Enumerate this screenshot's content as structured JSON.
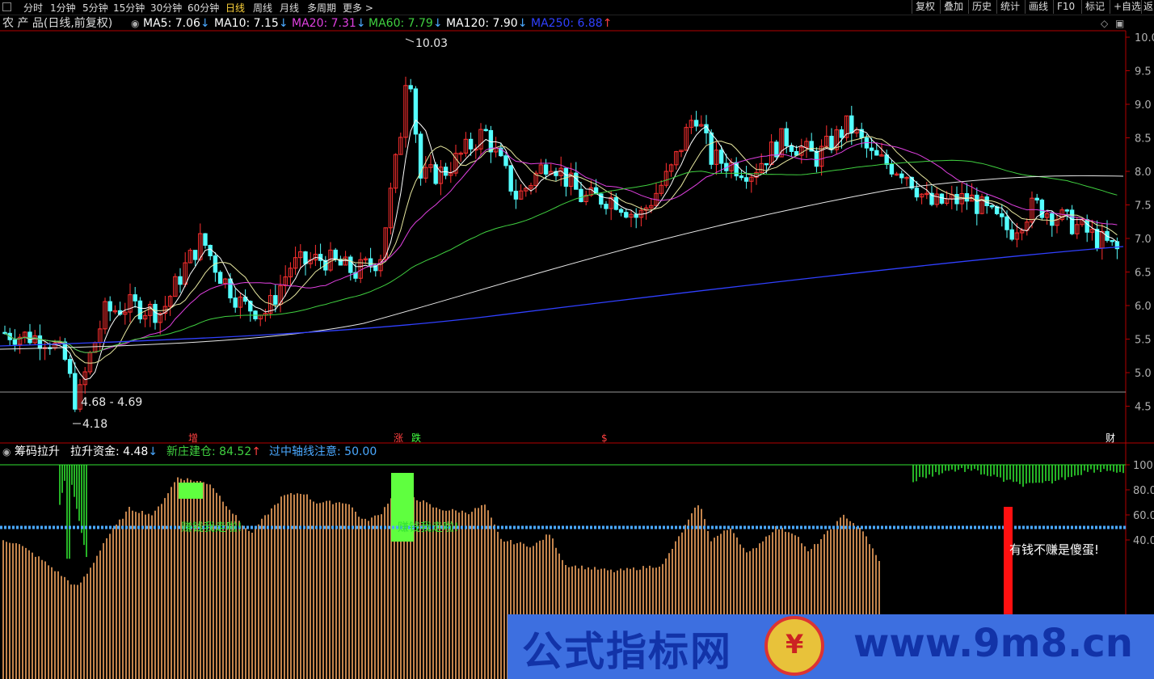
{
  "toolbar": {
    "periods": [
      "分时",
      "1分钟",
      "5分钟",
      "15分钟",
      "30分钟",
      "60分钟",
      "日线",
      "周线",
      "月线",
      "多周期",
      "更多 >"
    ],
    "selected": "日线",
    "right_buttons": [
      "复权",
      "叠加",
      "历史",
      "统计",
      "画线",
      "F10",
      "标记",
      "+自选",
      "返"
    ]
  },
  "main_panel": {
    "title": "农 产 品(日线,前复权)",
    "ma": [
      {
        "label": "MA5: 7.06",
        "arrow": "↓",
        "color": "#ffffff"
      },
      {
        "label": "MA10: 7.15",
        "arrow": "↓",
        "color": "#ffffff"
      },
      {
        "label": "MA20: 7.31",
        "arrow": "↓",
        "color": "#e040e0"
      },
      {
        "label": "MA60: 7.79",
        "arrow": "↓",
        "color": "#40d040"
      },
      {
        "label": "MA120: 7.90",
        "arrow": "↓",
        "color": "#ffffff"
      },
      {
        "label": "MA250: 6.88",
        "arrow": "↑",
        "color": "#3040ff"
      }
    ],
    "y_axis": [
      "10.0",
      "9.5",
      "9.0",
      "8.5",
      "8.0",
      "7.5",
      "7.0",
      "6.5",
      "6.0",
      "5.5",
      "5.0",
      "4.5"
    ],
    "annotations": {
      "high": "10.03",
      "range": "4.68 - 4.69",
      "low": "4.18"
    },
    "event_marks": [
      {
        "text": "增",
        "color": "#ff4040"
      },
      {
        "text": "涨",
        "color": "#ff4040"
      },
      {
        "text": "跌",
        "color": "#40ff40"
      },
      {
        "text": "$",
        "color": "#ff4040"
      },
      {
        "text": "财",
        "color": "#ffffff"
      }
    ]
  },
  "indicator_panel": {
    "name": "筹码拉升",
    "items": [
      {
        "label": "拉升资金: 4.48",
        "arrow": "↓",
        "color": "#ffffff"
      },
      {
        "label": "新庄建仓: 84.52",
        "arrow": "↑",
        "color": "#40d040"
      },
      {
        "label": "过中轴线注意: 50.00",
        "arrow": "",
        "color": "#4aa8ff"
      }
    ],
    "y_axis": [
      "100",
      "80.0",
      "60.0",
      "40.0"
    ],
    "texts": {
      "run1": "赚钱我走啦!",
      "run2": "赚钱我走啦!",
      "fool": "有钱不赚是傻蛋!"
    }
  },
  "watermark": {
    "cn": "公式指标网",
    "url": "www.9m8.cn"
  },
  "colors": {
    "up": "#ff3030",
    "down": "#54ffff",
    "bar": "#f5a560",
    "green": "#30e030",
    "axis": "#b40000"
  }
}
